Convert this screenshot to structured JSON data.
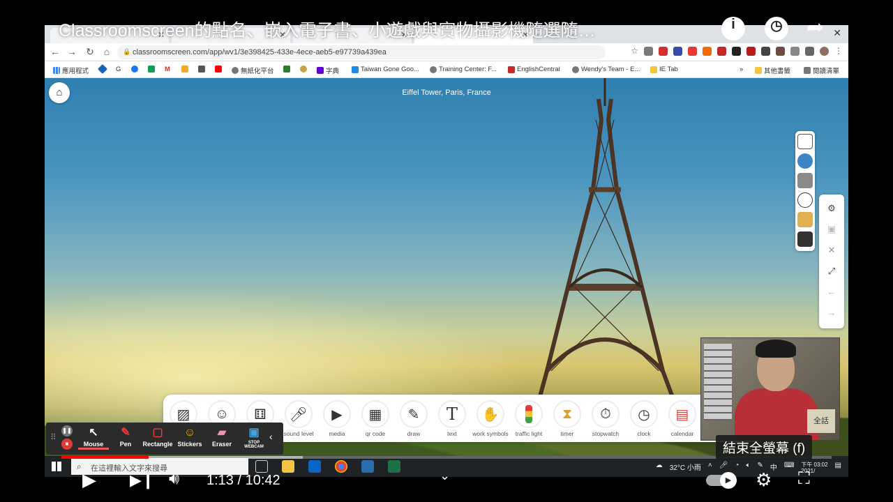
{
  "youtube": {
    "title": "Classroomscreen的點名、嵌入電子書、小遊戲與實物攝影機隨選隨…",
    "time_current": "1:13",
    "time_separator": " / ",
    "time_total": "10:42",
    "progress_fraction": 0.113,
    "tooltip": "結束全螢幕 (f)",
    "icons": {
      "info": "info-icon",
      "watch_later": "clock-icon",
      "share": "share-icon",
      "play": "play-icon",
      "next": "next-icon",
      "volume": "volume-icon",
      "settings": "gear-icon",
      "exit_fullscreen": "exit-fullscreen-icon"
    }
  },
  "browser": {
    "url": "classroomscreen.com/app/wv1/3e398425-433e-4ece-aeb5-e97739a439ea",
    "bookmarks": [
      "應用程式",
      "G",
      "",
      "",
      "M",
      "",
      "",
      "",
      "無紙化平台",
      "",
      "",
      "字典",
      "Taiwan Gone Goo...",
      "Training Center: F...",
      "EnglishCentral",
      "Wendy's Team - E...",
      "IE Tab"
    ],
    "bookmarks_right": [
      "其他書籤",
      "閱讀清單"
    ]
  },
  "classroom": {
    "background_caption": "Eiffel Tower, Paris, France",
    "widgets": [
      {
        "label": "",
        "icon": "image-icon"
      },
      {
        "label": "",
        "icon": "people-icon"
      },
      {
        "label": "",
        "icon": "dice-icon"
      },
      {
        "label": "sound level",
        "icon": "microphone-icon"
      },
      {
        "label": "media",
        "icon": "media-icon"
      },
      {
        "label": "qr code",
        "icon": "qr-code-icon"
      },
      {
        "label": "draw",
        "icon": "pencil-icon"
      },
      {
        "label": "text",
        "icon": "text-icon"
      },
      {
        "label": "work symbols",
        "icon": "work-symbols-icon"
      },
      {
        "label": "traffic light",
        "icon": "traffic-light-icon"
      },
      {
        "label": "timer",
        "icon": "hourglass-icon"
      },
      {
        "label": "stopwatch",
        "icon": "stopwatch-icon"
      },
      {
        "label": "clock",
        "icon": "clock-icon"
      },
      {
        "label": "calendar",
        "icon": "calendar-icon"
      }
    ]
  },
  "recorder": {
    "tools": [
      {
        "label": "Mouse",
        "icon": "cursor-icon",
        "color": "#ffffff"
      },
      {
        "label": "Pen",
        "icon": "pen-icon",
        "color": "#e53935"
      },
      {
        "label": "Rectangle",
        "icon": "rectangle-icon",
        "color": "#e53935"
      },
      {
        "label": "Stickers",
        "icon": "sticker-icon",
        "color": "#f5b400"
      },
      {
        "label": "Eraser",
        "icon": "eraser-icon",
        "color": "#f48fb1"
      },
      {
        "label": "STOP WEBCAM",
        "icon": "webcam-icon",
        "color": "#4aa3df"
      }
    ]
  },
  "taskbar": {
    "search_placeholder": "在這裡輸入文字來搜尋",
    "weather": "32°C 小雨",
    "ime": "中",
    "time": "下午 03:02",
    "date": "2021/"
  },
  "webcam": {
    "logo_text": "全話"
  }
}
